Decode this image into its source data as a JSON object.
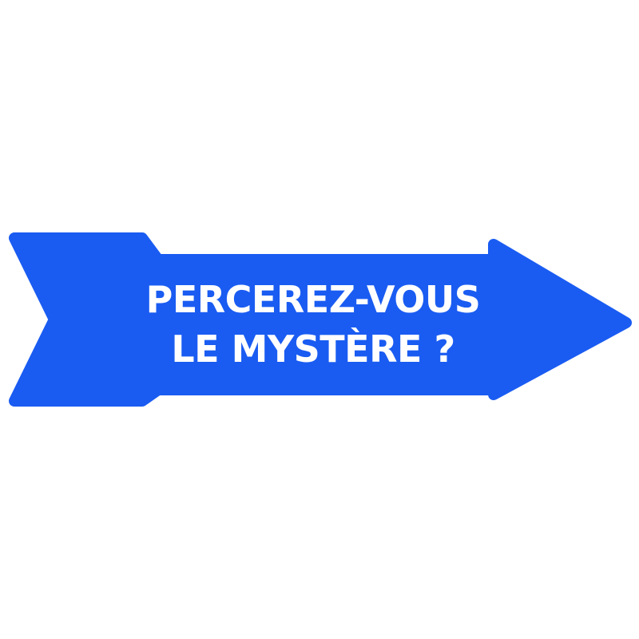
{
  "sign": {
    "line1": "PERCEREZ-VOUS",
    "line2": "LE MYSTÈRE ?"
  },
  "colors": {
    "arrow_fill": "#1a5cf2",
    "text": "#ffffff",
    "background": "#ffffff"
  },
  "icons": {
    "arrow": "arrow-right-icon"
  }
}
